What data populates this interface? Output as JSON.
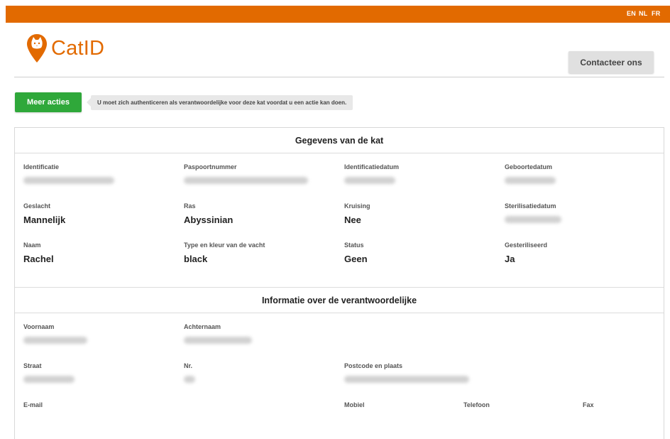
{
  "languages": [
    "EN",
    "NL",
    "FR"
  ],
  "brand": {
    "name": "CatID",
    "color": "#e26a00"
  },
  "header": {
    "contact_label": "Contacteer ons"
  },
  "actions": {
    "more_label": "Meer acties",
    "notice": "U moet zich authenticeren als verantwoordelijke voor deze kat voordat u een actie kan doen."
  },
  "cat": {
    "title": "Gegevens van de kat",
    "identification_label": "Identificatie",
    "passport_label": "Paspoortnummer",
    "id_date_label": "Identificatiedatum",
    "birth_date_label": "Geboortedatum",
    "sex_label": "Geslacht",
    "sex": "Mannelijk",
    "breed_label": "Ras",
    "breed": "Abyssinian",
    "cross_label": "Kruising",
    "cross": "Nee",
    "sterilisation_date_label": "Sterilisatiedatum",
    "name_label": "Naam",
    "name": "Rachel",
    "coat_label": "Type en kleur van de vacht",
    "coat": "black",
    "status_label": "Status",
    "status": "Geen",
    "sterilised_label": "Gesteriliseerd",
    "sterilised": "Ja"
  },
  "owner": {
    "title": "Informatie over de verantwoordelijke",
    "firstname_label": "Voornaam",
    "lastname_label": "Achternaam",
    "street_label": "Straat",
    "number_label": "Nr.",
    "postal_label": "Postcode en plaats",
    "email_label": "E-mail",
    "mobile_label": "Mobiel",
    "phone_label": "Telefoon",
    "fax_label": "Fax"
  },
  "colors": {
    "accent": "#e26a00",
    "action": "#2fa83a"
  }
}
